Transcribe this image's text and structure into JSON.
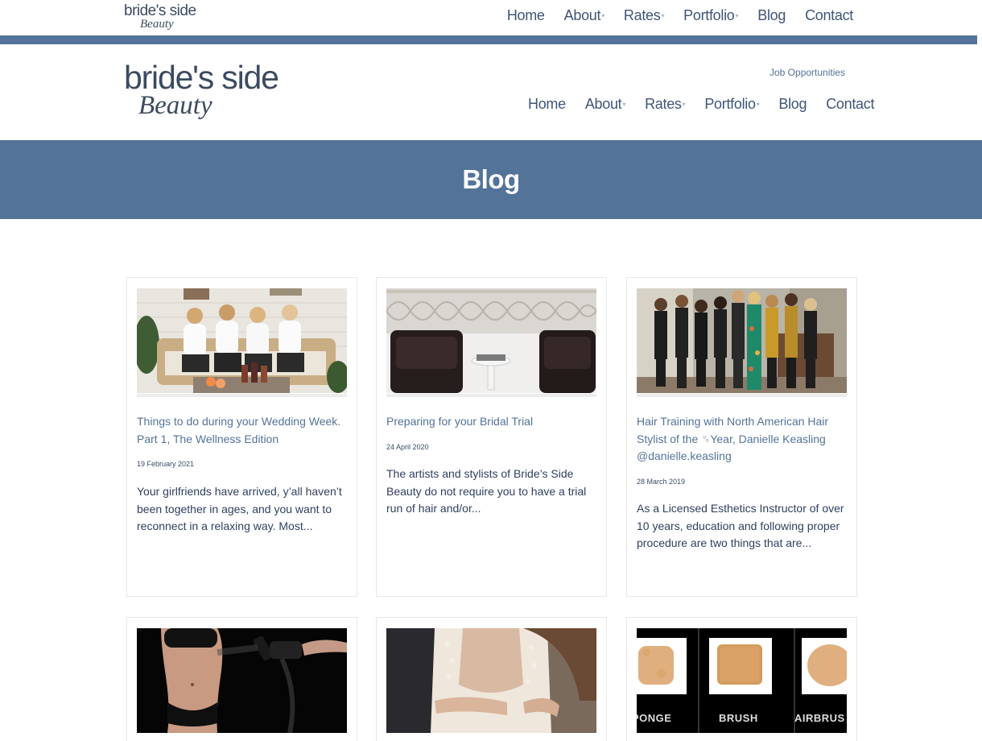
{
  "brand": {
    "name_top": "bride's side",
    "name_bottom": "Beauty"
  },
  "nav": [
    {
      "label": "Home",
      "dropdown": false
    },
    {
      "label": "About",
      "dropdown": true
    },
    {
      "label": "Rates",
      "dropdown": true
    },
    {
      "label": "Portfolio",
      "dropdown": true
    },
    {
      "label": "Blog",
      "dropdown": false
    },
    {
      "label": "Contact",
      "dropdown": false
    }
  ],
  "job_link": "Job Opportunities",
  "page_title": "Blog",
  "colors": {
    "accent": "#537399",
    "text": "#2f3f5f",
    "link": "#537399"
  },
  "posts": [
    {
      "title": "Things to do during your Wedding Week. Part 1, The Wellness Edition",
      "date": "19 February 2021",
      "excerpt": "Your girlfriends have arrived, y’all haven’t been together in ages, and you want to reconnect in a relaxing way. Most..."
    },
    {
      "title": "Preparing for your Bridal Trial",
      "date": "24 April 2020",
      "excerpt": "The artists and stylists of Bride’s Side Beauty do not require you to have a trial run of hair and/or..."
    },
    {
      "title": "Hair Training with North American Hair Stylist of the ␟Year, Danielle Keasling @danielle.keasling",
      "date": "28 March 2019",
      "excerpt": "As a Licensed Esthetics Instructor of over 10 years, education and following proper procedure are two things that are..."
    },
    {
      "title": "",
      "date": "",
      "excerpt": ""
    },
    {
      "title": "",
      "date": "",
      "excerpt": ""
    },
    {
      "title": "",
      "date": "",
      "excerpt": ""
    }
  ],
  "brush_labels": [
    "PONGE",
    "BRUSH",
    "AIRBRUS"
  ]
}
